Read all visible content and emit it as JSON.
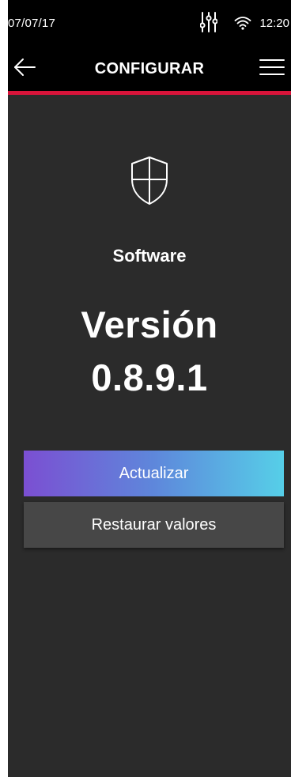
{
  "status_bar": {
    "date": "07/07/17",
    "time": "12:20",
    "icons": [
      "equalizer-icon",
      "wifi-icon"
    ]
  },
  "header": {
    "title": "CONFIGURAR",
    "back_icon": "back-arrow-icon",
    "menu_icon": "hamburger-menu-icon",
    "accent_color": "#d8143a"
  },
  "main": {
    "icon": "shield-icon",
    "section_label": "Software",
    "version_title": "Versión",
    "version_number": "0.8.9.1",
    "update_button": "Actualizar",
    "restore_button": "Restaurar valores"
  },
  "colors": {
    "background": "#2b2b2b",
    "bar": "#000000",
    "gradient_start": "#7b4fd2",
    "gradient_end": "#56cfe8",
    "secondary_button": "#474747"
  }
}
